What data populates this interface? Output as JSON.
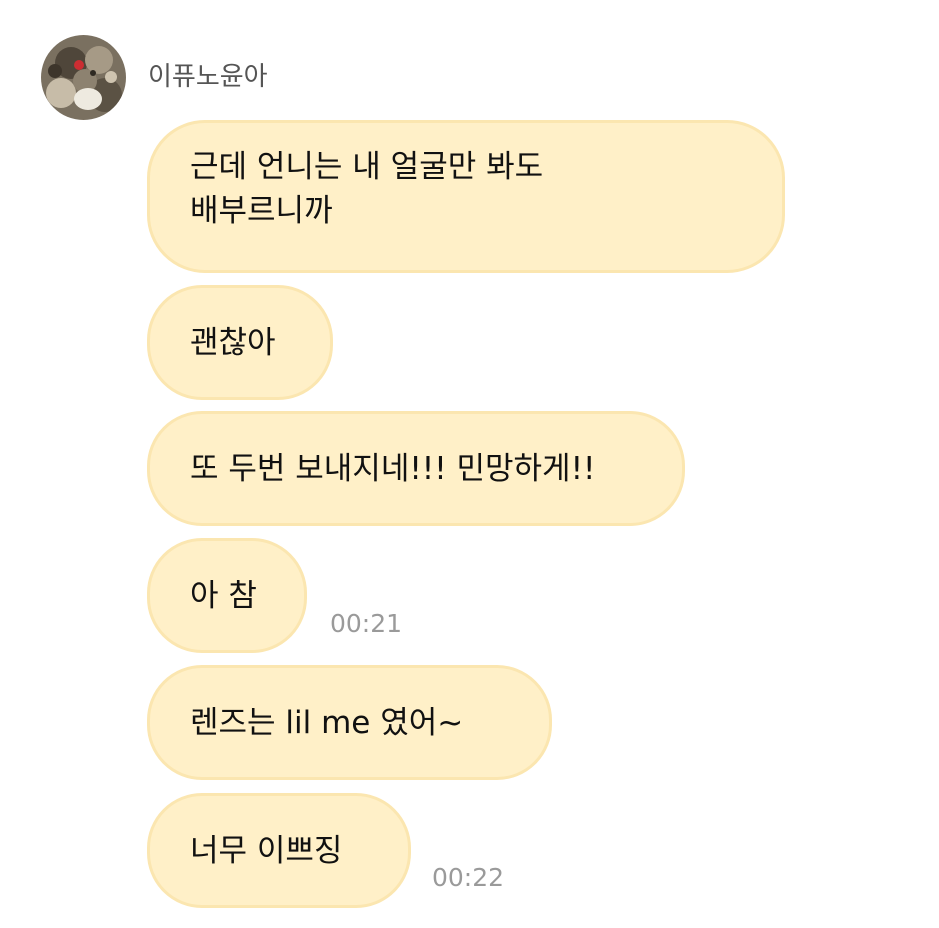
{
  "sender": {
    "name": "이퓨노윤아",
    "avatar_icon": "profile-photo-icon"
  },
  "messages": [
    {
      "lines": [
        "근데 언니는 내 얼굴만 봐도",
        "배부르니까"
      ],
      "time": ""
    },
    {
      "lines": [
        "괜찮아"
      ],
      "time": ""
    },
    {
      "lines": [
        "또 두번 보내지네!!! 민망하게!!"
      ],
      "time": ""
    },
    {
      "lines": [
        "아 참"
      ],
      "time": "00:21"
    },
    {
      "lines": [
        "렌즈는 lil me  였어~"
      ],
      "time": ""
    },
    {
      "lines": [
        "너무 이쁘징"
      ],
      "time": "00:22"
    }
  ],
  "colors": {
    "bubble_fill": "#fff0c8",
    "bubble_border": "#fbe6b0",
    "timestamp": "#9a9a9a",
    "name": "#555555"
  }
}
